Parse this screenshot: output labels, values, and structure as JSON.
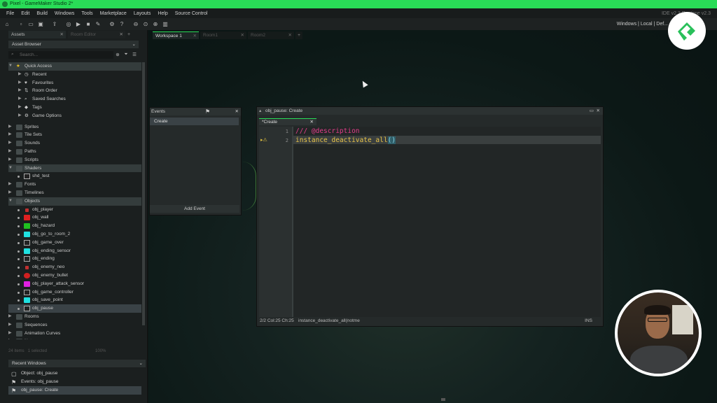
{
  "window_title": "Pixel - GameMaker Studio 2*",
  "menu": [
    "File",
    "Edit",
    "Build",
    "Windows",
    "Tools",
    "Marketplace",
    "Layouts",
    "Help",
    "Source Control"
  ],
  "menu_right": "IDE v2.3  Runtime v2.3",
  "toolbar_right": "Windows | Local | Def...",
  "left_tabs": [
    {
      "label": "Assets"
    },
    {
      "label": "Room Editor"
    }
  ],
  "asset_browser": {
    "title": "Asset Browser",
    "search_placeholder": "Search..."
  },
  "tree": [
    {
      "label": "Quick Access",
      "type": "group",
      "expanded": true,
      "icon": "star-icon",
      "hl": true
    },
    {
      "label": "Recent",
      "type": "qa",
      "icon": "clock-icon"
    },
    {
      "label": "Favourites",
      "type": "qa",
      "icon": "heart-icon"
    },
    {
      "label": "Room Order",
      "type": "qa",
      "icon": "room-order-icon"
    },
    {
      "label": "Saved Searches",
      "type": "qa",
      "icon": "search-icon"
    },
    {
      "label": "Tags",
      "type": "qa",
      "icon": "tag-icon"
    },
    {
      "label": "Game Options",
      "type": "qa",
      "icon": "gear-icon"
    },
    {
      "label": "",
      "type": "spacer"
    },
    {
      "label": "Sprites",
      "type": "folder"
    },
    {
      "label": "Tile Sets",
      "type": "folder"
    },
    {
      "label": "Sounds",
      "type": "folder"
    },
    {
      "label": "Paths",
      "type": "folder"
    },
    {
      "label": "Scripts",
      "type": "folder"
    },
    {
      "label": "Shaders",
      "type": "folder",
      "expanded": true,
      "hl": true
    },
    {
      "label": "shd_test",
      "type": "item",
      "icon": "shader-icon"
    },
    {
      "label": "Fonts",
      "type": "folder"
    },
    {
      "label": "Timelines",
      "type": "folder"
    },
    {
      "label": "Objects",
      "type": "folder",
      "expanded": true,
      "hl": true
    },
    {
      "label": "obj_player",
      "type": "obj",
      "color": "#c03030",
      "small": true
    },
    {
      "label": "obj_wall",
      "type": "obj",
      "color": "#e02020"
    },
    {
      "label": "obj_hazard",
      "type": "obj",
      "color": "#20c020"
    },
    {
      "label": "obj_go_to_room_2",
      "type": "obj",
      "color": "#20e0e0"
    },
    {
      "label": "obj_game_over",
      "type": "obj",
      "color": "outline"
    },
    {
      "label": "obj_ending_sensor",
      "type": "obj",
      "color": "#20e0e0"
    },
    {
      "label": "obj_ending",
      "type": "obj",
      "color": "outline"
    },
    {
      "label": "obj_enemy_neo",
      "type": "obj",
      "color": "#c03030",
      "small": true
    },
    {
      "label": "obj_enemy_bullet",
      "type": "obj",
      "color": "#d02020",
      "round": true
    },
    {
      "label": "obj_player_attack_sensor",
      "type": "obj",
      "color": "#e020e0"
    },
    {
      "label": "obj_game_controller",
      "type": "obj",
      "color": "outline"
    },
    {
      "label": "obj_save_point",
      "type": "obj",
      "color": "#20e0e0"
    },
    {
      "label": "obj_pause",
      "type": "obj",
      "color": "outline",
      "selected": true
    },
    {
      "label": "Rooms",
      "type": "folder"
    },
    {
      "label": "Sequences",
      "type": "folder"
    },
    {
      "label": "Animation Curves",
      "type": "folder"
    },
    {
      "label": "Notes",
      "type": "folder"
    }
  ],
  "left_status": {
    "items": "24 items",
    "selected": "1 selected",
    "zoom": "100%"
  },
  "recent_windows": {
    "title": "Recent Windows",
    "items": [
      {
        "label": "Object: obj_pause",
        "icon": "object-icon"
      },
      {
        "label": "Events: obj_pause",
        "icon": "flag-icon"
      },
      {
        "label": "obj_pause: Create",
        "icon": "flag-icon",
        "selected": true
      }
    ]
  },
  "workspace_tabs": [
    {
      "label": "Workspace 1",
      "active": true
    },
    {
      "label": "Room1"
    },
    {
      "label": "Room2"
    }
  ],
  "events_window": {
    "title": "Events",
    "event": "Create",
    "add_label": "Add Event"
  },
  "editor": {
    "title": "obj_pause: Create",
    "tab": "*Create",
    "lines": [
      {
        "num": "1",
        "text": "/// @description",
        "kind": "c"
      },
      {
        "num": "2",
        "text": "instance_deactivate_all",
        "kind": "f",
        "paren": "()"
      }
    ],
    "status_pos": "2/2 Col:25 Ch:25",
    "status_fn": "instance_deactivate_all(notme",
    "status_mode": "INS"
  },
  "colors": {
    "titlebar": "#29dc57",
    "accent": "#29dc57",
    "comment": "#e23d8a",
    "function": "#e9c44a"
  }
}
